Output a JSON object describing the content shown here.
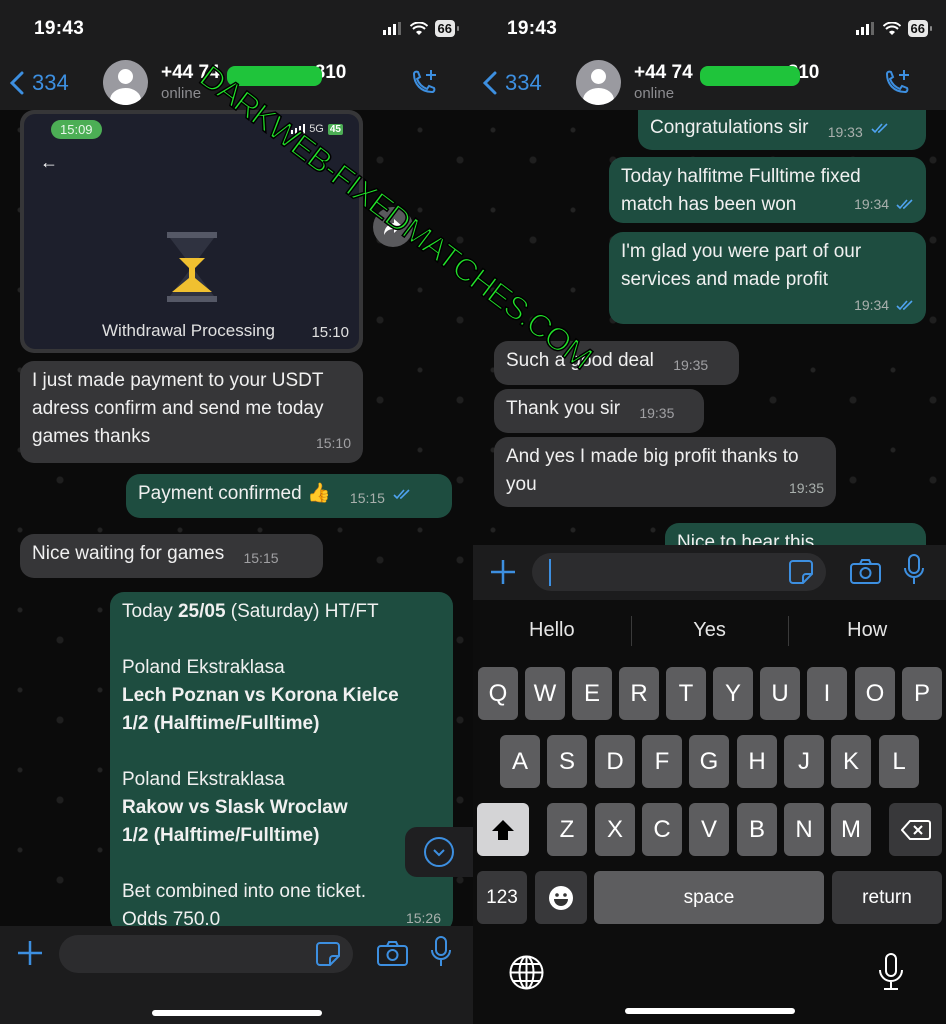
{
  "left_screen": {
    "status_bar": {
      "time": "19:43",
      "battery": "66"
    },
    "header": {
      "back_count": "334",
      "contact_name_prefix": "+44 74",
      "contact_name_suffix": "810",
      "contact_status": "online"
    },
    "image_message": {
      "embedded_time_pill": "15:09",
      "embedded_network": "5G",
      "embedded_battery": "45",
      "caption": "Withdrawal Processing",
      "time": "15:10"
    },
    "messages": [
      {
        "direction": "in",
        "text": "I just made payment to your USDT adress confirm and send me today games thanks",
        "time": "15:10"
      },
      {
        "direction": "out",
        "text": "Payment confirmed 👍",
        "time": "15:15",
        "status": "read"
      },
      {
        "direction": "in",
        "text": "Nice waiting for games",
        "time": "15:15"
      }
    ],
    "tips_message": {
      "line1_prefix": "Today ",
      "line1_date": "25/05",
      "line1_suffix": " (Saturday) HT/FT",
      "match1_league": "Poland Ekstraklasa",
      "match1_teams": "Lech Poznan vs Korona Kielce",
      "match1_pick": "1/2 (Halftime/Fulltime)",
      "match2_league": "Poland Ekstraklasa",
      "match2_teams": "Rakow vs Slask Wroclaw",
      "match2_pick": "1/2 (Halftime/Fulltime)",
      "combined": "Bet combined into one ticket.",
      "odds": "Odds 750.0",
      "time": "15:26"
    },
    "input": {
      "placeholder": "",
      "value": ""
    }
  },
  "right_screen": {
    "status_bar": {
      "time": "19:43",
      "battery": "66"
    },
    "header": {
      "back_count": "334",
      "contact_name_prefix": "+44 74",
      "contact_name_suffix": "810",
      "contact_status": "online"
    },
    "messages": [
      {
        "direction": "out",
        "text": "Congratulations sir",
        "time": "19:33",
        "status": "read"
      },
      {
        "direction": "out",
        "text": "Today halfitme Fulltime fixed match has been won",
        "time": "19:34",
        "status": "read"
      },
      {
        "direction": "out",
        "text": "I'm glad you were part of our services and made profit",
        "time": "19:34",
        "status": "read"
      },
      {
        "direction": "in",
        "text": "Such a good deal",
        "time": "19:35"
      },
      {
        "direction": "in",
        "text": "Thank you sir",
        "time": "19:35"
      },
      {
        "direction": "in",
        "text": "And yes I made big profit thanks to you",
        "time": "19:35"
      },
      {
        "direction": "out",
        "text": "Nice to hear this",
        "time": "",
        "partial": true
      }
    ],
    "input": {
      "placeholder": "",
      "value": ""
    },
    "suggestions": [
      "Hello",
      "Yes",
      "How"
    ],
    "keyboard": {
      "row1": [
        "Q",
        "W",
        "E",
        "R",
        "T",
        "Y",
        "U",
        "I",
        "O",
        "P"
      ],
      "row2": [
        "A",
        "S",
        "D",
        "F",
        "G",
        "H",
        "J",
        "K",
        "L"
      ],
      "row3": [
        "Z",
        "X",
        "C",
        "V",
        "B",
        "N",
        "M"
      ],
      "numbers_label": "123",
      "space_label": "space",
      "return_label": "return"
    }
  },
  "watermark": "DARKWEB-FIXEDMATCHES.COM",
  "colors": {
    "accent_blue": "#3d8fe0",
    "outgoing_bubble": "#1e4d40",
    "incoming_bubble": "#363638",
    "watermark_green": "#22e52a",
    "read_tick": "#4fa3f0"
  }
}
